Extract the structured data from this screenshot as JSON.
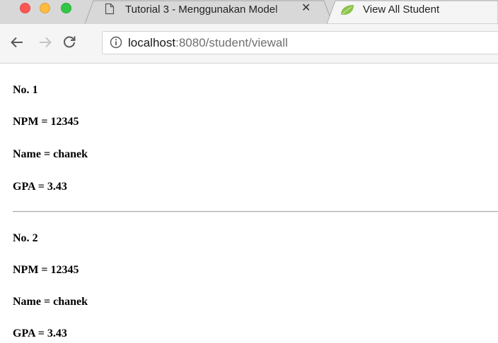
{
  "browser": {
    "tabs": [
      {
        "title": "Tutorial 3 - Menggunakan Model",
        "favicon": "blank-page-icon",
        "active": false
      },
      {
        "title": "View All Student",
        "favicon": "spring-leaf-icon",
        "active": true
      }
    ],
    "close_glyph": "✕",
    "address_bar": {
      "host": "localhost",
      "path": ":8080/student/viewall"
    }
  },
  "students": [
    {
      "no_label": "No.",
      "no": "1",
      "npm_label": "NPM =",
      "npm": "12345",
      "name_label": "Name =",
      "name": "chanek",
      "gpa_label": "GPA =",
      "gpa": "3.43"
    },
    {
      "no_label": "No.",
      "no": "2",
      "npm_label": "NPM =",
      "npm": "12345",
      "name_label": "Name =",
      "name": "chanek",
      "gpa_label": "GPA =",
      "gpa": "3.43"
    }
  ],
  "colors": {
    "tab_strip": "#d8d8d8",
    "toolbar": "#f5f5f5",
    "leaf": "#8bc34a"
  }
}
